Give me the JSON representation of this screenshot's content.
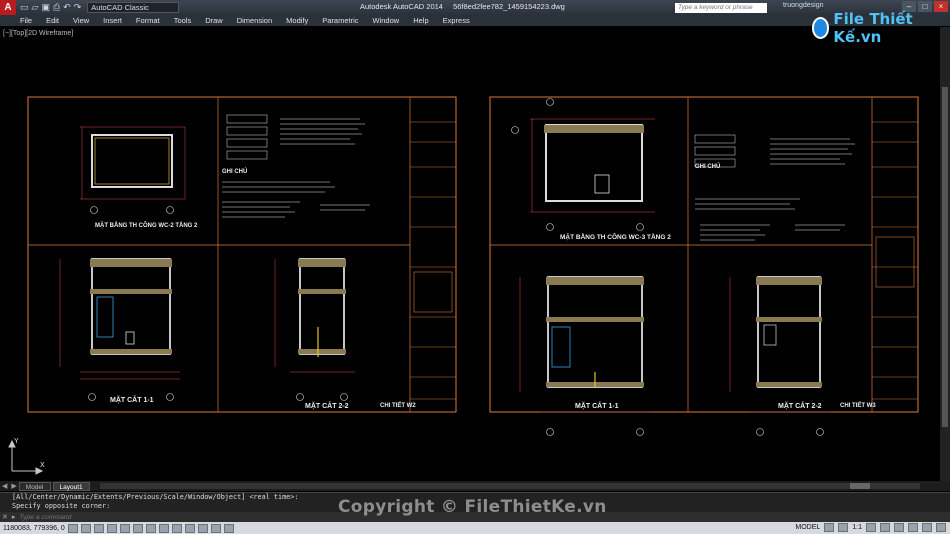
{
  "titlebar": {
    "app_logo": "A",
    "workspace": "AutoCAD Classic",
    "app_name": "Autodesk AutoCAD 2014",
    "file_name": "56f8ed2fee782_1459154223.dwg",
    "search_placeholder": "Type a keyword or phrase",
    "user": "truongdesign"
  },
  "menu": [
    "File",
    "Edit",
    "View",
    "Insert",
    "Format",
    "Tools",
    "Draw",
    "Dimension",
    "Modify",
    "Parametric",
    "Window",
    "Help",
    "Express"
  ],
  "brand": {
    "text": "File Thiết Kế.vn"
  },
  "viewport_label": "[−][Top][2D Wireframe]",
  "sheets": [
    {
      "plan_title": "MẶT BẰNG TH CÔNG WC-2 TẦNG 2",
      "section1_title": "MẶT CẮT 1-1",
      "section2_title": "MẶT CẮT 2-2",
      "notes_title": "GHI CHÚ",
      "detail_title": "CHI TIẾT W2"
    },
    {
      "plan_title": "MẶT BẰNG TH CÔNG WC-3 TẦNG 2",
      "section1_title": "MẶT CẮT 1-1",
      "section2_title": "MẶT CẮT 2-2",
      "notes_title": "GHI CHÚ",
      "detail_title": "CHI TIẾT W3"
    }
  ],
  "tabs": [
    "Model",
    "Layout1"
  ],
  "command": {
    "history_1": "[All/Center/Dynamic/Extents/Previous/Scale/Window/Object] <real time>:",
    "history_2": "Specify opposite corner:",
    "placeholder": "Type a command"
  },
  "status": {
    "coords": "1180083, 779396, 0",
    "model": "MODEL",
    "scale": "1:1"
  },
  "watermark": "Copyright © FileThietKe.vn"
}
